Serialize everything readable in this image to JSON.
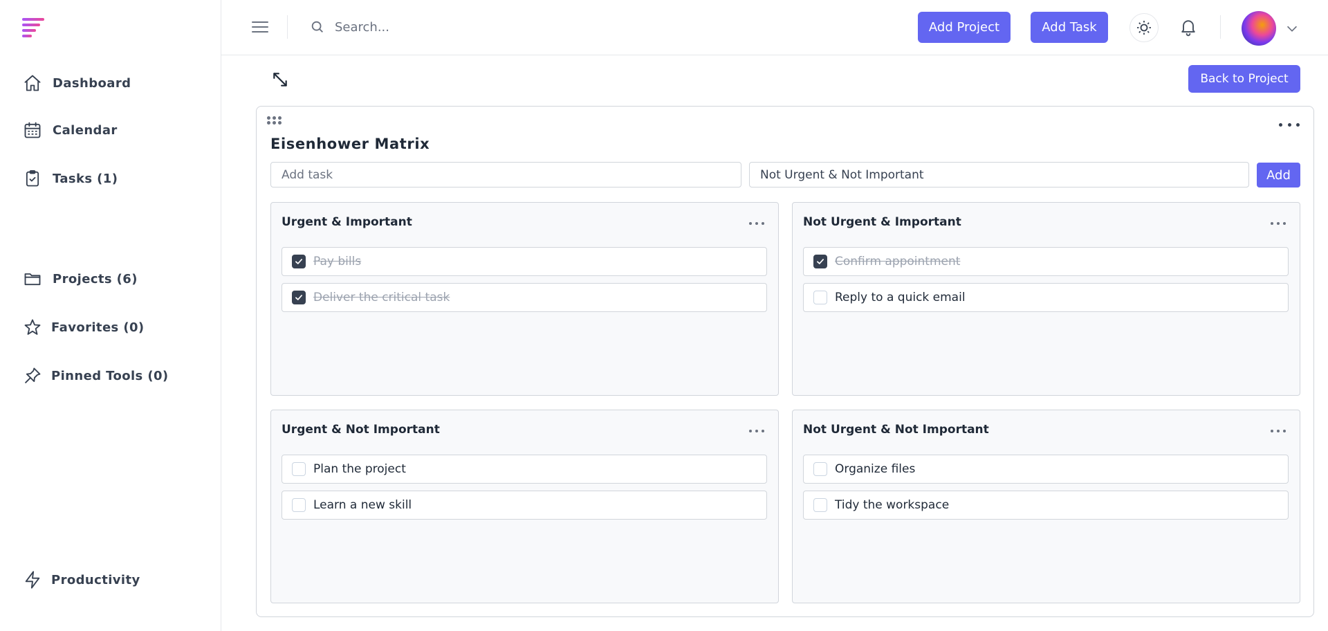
{
  "sidebar": {
    "logo_icon": "brand-logo-icon",
    "top_items": [
      {
        "label": "Dashboard",
        "icon": "home-icon"
      },
      {
        "label": "Calendar",
        "icon": "calendar-icon"
      },
      {
        "label": "Tasks (1)",
        "icon": "clipboard-check-icon"
      }
    ],
    "mid_items": [
      {
        "label": "Projects (6)",
        "icon": "folder-icon"
      },
      {
        "label": "Favorites (0)",
        "icon": "star-icon"
      },
      {
        "label": "Pinned Tools (0)",
        "icon": "pin-icon"
      }
    ],
    "bottom_items": [
      {
        "label": "Productivity",
        "icon": "lightning-icon"
      }
    ]
  },
  "header": {
    "search_placeholder": "Search...",
    "add_project_label": "Add Project",
    "add_task_label": "Add Task"
  },
  "toolbar": {
    "back_label": "Back to Project"
  },
  "widget": {
    "title": "Eisenhower Matrix",
    "add_placeholder": "Add task",
    "selected_quadrant": "Not Urgent & Not Important",
    "add_label": "Add",
    "quadrants": [
      {
        "title": "Urgent & Important",
        "tasks": [
          {
            "text": "Pay bills",
            "done": true
          },
          {
            "text": "Deliver the critical task",
            "done": true
          }
        ]
      },
      {
        "title": "Not Urgent & Important",
        "tasks": [
          {
            "text": "Confirm appointment",
            "done": true
          },
          {
            "text": "Reply to a quick email",
            "done": false
          }
        ]
      },
      {
        "title": "Urgent & Not Important",
        "tasks": [
          {
            "text": "Plan the project",
            "done": false
          },
          {
            "text": "Learn a new skill",
            "done": false
          }
        ]
      },
      {
        "title": "Not Urgent & Not Important",
        "tasks": [
          {
            "text": "Organize files",
            "done": false
          },
          {
            "text": "Tidy the workspace",
            "done": false
          }
        ]
      }
    ]
  },
  "colors": {
    "accent": "#6366f1",
    "checkbox_checked": "#374151",
    "done_text": "#9ca3af"
  }
}
